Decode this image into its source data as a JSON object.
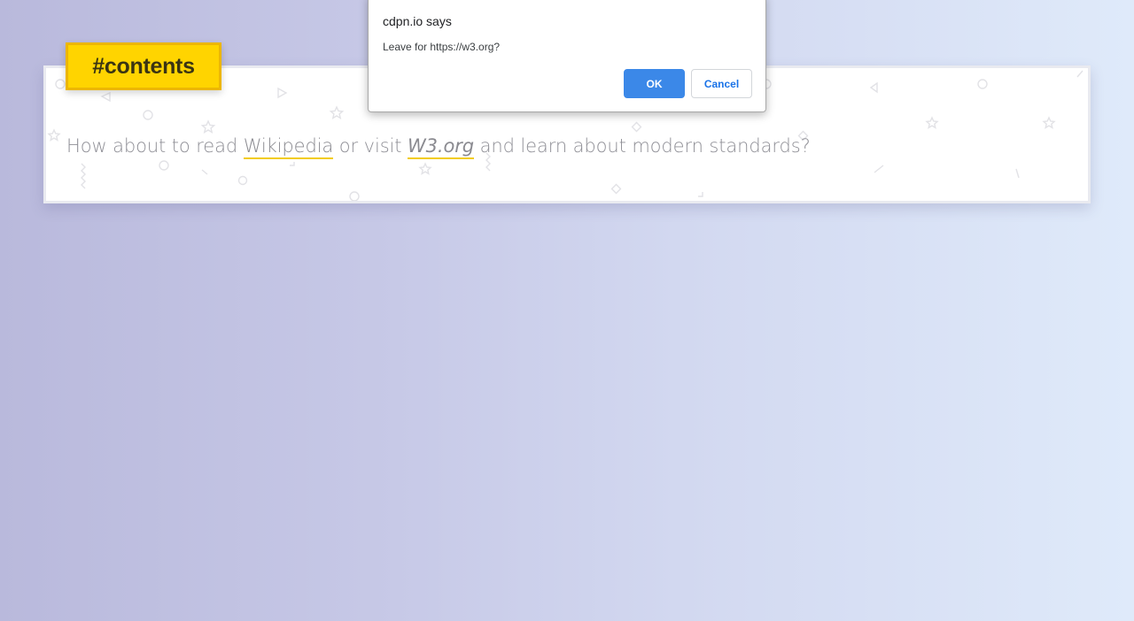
{
  "tag": {
    "label": "#contents",
    "color": "#ffd400"
  },
  "card": {
    "text_before": "How about to read ",
    "link_wikipedia": "Wikipedia",
    "text_middle": " or visit ",
    "link_w3": "W3.org",
    "text_after": " and learn about modern standards?",
    "link_underline_color": "#f2cc17"
  },
  "dialog": {
    "title": "cdpn.io says",
    "message": "Leave for https://w3.org?",
    "ok_label": "OK",
    "cancel_label": "Cancel",
    "ok_color": "#3b88e8"
  },
  "decor": {
    "icons": [
      "circle-icon",
      "triangle-icon",
      "star-icon",
      "diamond-icon",
      "zigzag-icon",
      "line-icon"
    ]
  }
}
